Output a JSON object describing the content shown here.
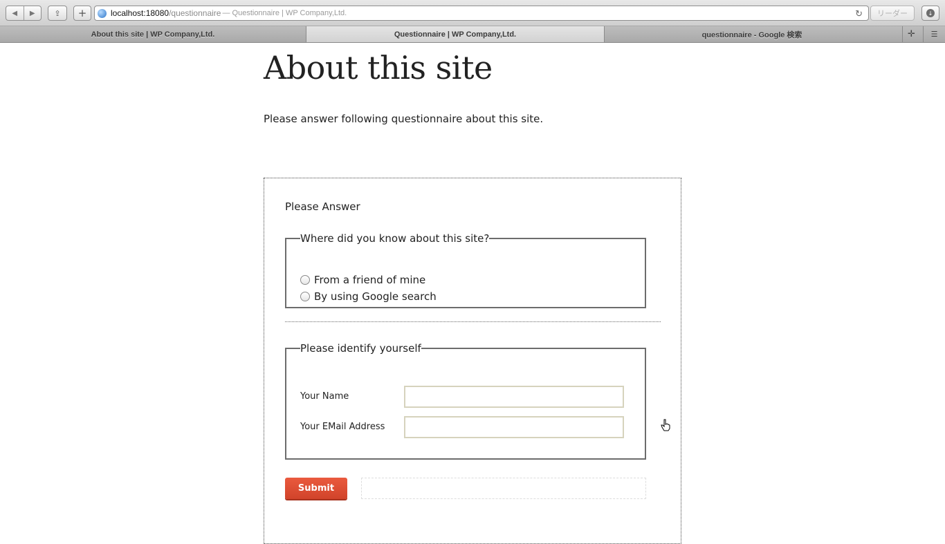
{
  "browser": {
    "url_host": "localhost:18080",
    "url_path": "/questionnaire",
    "url_page_title": "— Questionnaire | WP Company,Ltd.",
    "reader_label": "リーダー",
    "tabs": [
      {
        "label": "About this site | WP Company,Ltd.",
        "active": false
      },
      {
        "label": "Questionnaire | WP Company,Ltd.",
        "active": true
      },
      {
        "label": "questionnaire - Google 検索",
        "active": false
      }
    ],
    "icons": [
      "back-arrow-icon",
      "forward-arrow-icon",
      "share-icon",
      "add-bookmark-icon",
      "globe-icon",
      "reload-icon",
      "download-icon",
      "new-tab-icon",
      "tab-overview-icon"
    ]
  },
  "page": {
    "title": "About this site",
    "intro": "Please answer following questionnaire about this site."
  },
  "form": {
    "title": "Please Answer",
    "section1": {
      "legend": "Where did you know about this site?",
      "options": [
        "From a friend of mine",
        "By using Google search"
      ]
    },
    "section2": {
      "legend": "Please identify yourself",
      "name_label": "Your Name",
      "email_label": "Your EMail Address",
      "name_value": "",
      "email_value": ""
    },
    "submit_label": "Submit"
  }
}
